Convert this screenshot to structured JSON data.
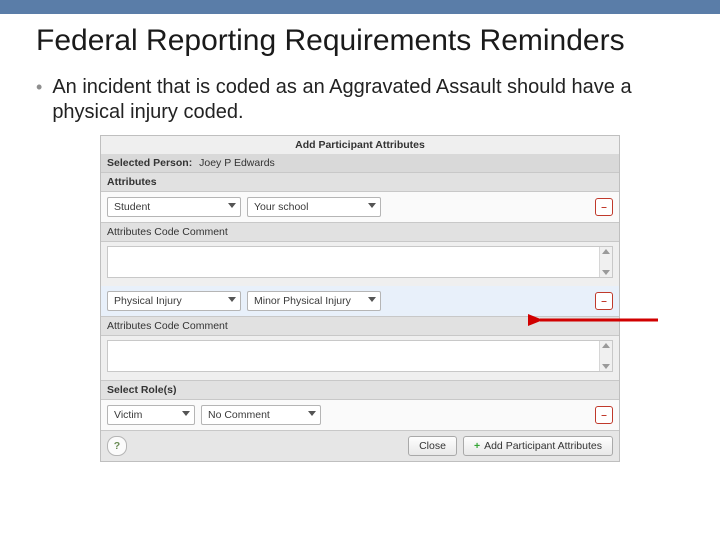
{
  "slide": {
    "title": "Federal Reporting Requirements Reminders",
    "bullet": "An incident that is coded as an Aggravated Assault should have a physical injury coded."
  },
  "panel": {
    "head": "Add Participant Attributes",
    "selected_label": "Selected Person:",
    "selected_value": "Joey P Edwards",
    "attributes_label": "Attributes",
    "row1": {
      "dd1": "Student",
      "dd2": "Your school"
    },
    "row2": {
      "dd1": "Physical Injury",
      "dd2": "Minor Physical Injury"
    },
    "comment_label": "Attributes Code Comment",
    "roles_label": "Select Role(s)",
    "roles": {
      "dd1": "Victim",
      "dd2": "No Comment"
    },
    "footer": {
      "close": "Close",
      "primary": "Add Participant Attributes"
    }
  },
  "icons": {
    "delete_glyph": "–",
    "help_glyph": "?",
    "plus_glyph": "+"
  }
}
